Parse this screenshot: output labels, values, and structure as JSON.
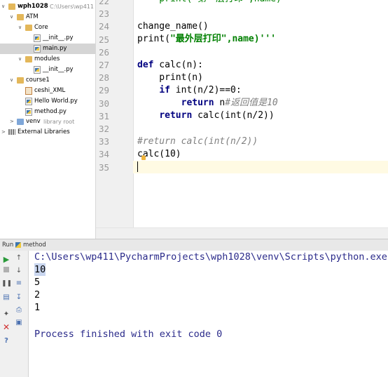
{
  "project": {
    "rows": [
      {
        "label": "wph1028",
        "extra": "C:\\Users\\wp411",
        "arrow": "∨",
        "icon": "folder"
      },
      {
        "label": "ATM",
        "arrow": "∨",
        "icon": "folder"
      },
      {
        "label": "Core",
        "arrow": "∨",
        "icon": "folder"
      },
      {
        "label": "__init__.py",
        "icon": "py"
      },
      {
        "label": "main.py",
        "icon": "py"
      },
      {
        "label": "modules",
        "arrow": "∨",
        "icon": "folder"
      },
      {
        "label": "__init__.py",
        "icon": "py"
      },
      {
        "label": "course1",
        "arrow": "∨",
        "icon": "folder"
      },
      {
        "label": "ceshi_XML",
        "icon": "xml"
      },
      {
        "label": "Hello World.py",
        "icon": "py"
      },
      {
        "label": "method.py",
        "icon": "py"
      },
      {
        "label": "venv",
        "extra": "library root",
        "arrow": ">",
        "icon": "folder-blue"
      },
      {
        "label": "External Libraries",
        "arrow": ">",
        "icon": "lib"
      }
    ]
  },
  "editor": {
    "line_numbers": [
      "22",
      "23",
      "24",
      "25",
      "26",
      "27",
      "28",
      "29",
      "30",
      "31",
      "32",
      "33",
      "34",
      "35"
    ],
    "top_partial": "    print(\"第一层打印\",name)",
    "lines": [
      {
        "t1": "change_name()"
      },
      {
        "t1": "print(",
        "str": "\"最外层打印\",name)'''"
      },
      {
        "t1": ""
      },
      {
        "kw": "def",
        "t1": " calc(n):"
      },
      {
        "t1": "    print(n)"
      },
      {
        "pre": "    ",
        "kw": "if",
        "t1": " int(n/2)==0:"
      },
      {
        "pre": "        ",
        "kw": "return",
        "t1": " n",
        "cm": "#返回值是10"
      },
      {
        "pre": "    ",
        "kw": "return",
        "t1": " calc(int(n/2))"
      },
      {
        "t1": ""
      },
      {
        "cm": "#return calc(int(n/2))"
      },
      {
        "t1": "calc(10)"
      },
      {
        "t1": ""
      },
      {
        "t1": ""
      }
    ]
  },
  "run": {
    "tab_label": "Run",
    "config_name": "method",
    "command": "C:\\Users\\wp411\\PycharmProjects\\wph1028\\venv\\Scripts\\python.exe",
    "output": [
      "10",
      "5",
      "2",
      "1"
    ],
    "exit_message": "Process finished with exit code 0"
  },
  "colors": {
    "keyword": "#000080",
    "string": "#008000",
    "comment": "#808080",
    "current_line": "#fffae3"
  }
}
